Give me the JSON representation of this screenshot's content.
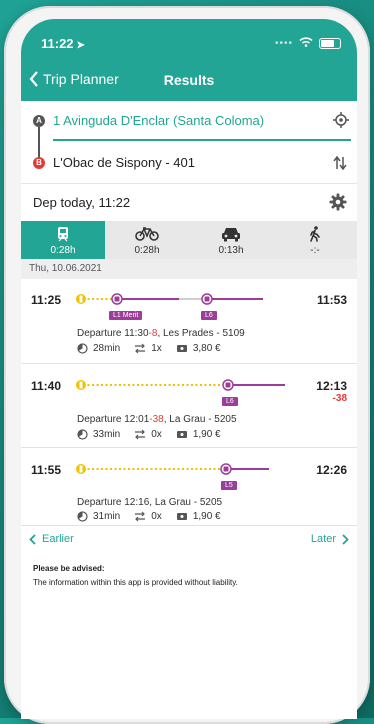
{
  "status": {
    "time": "11:22"
  },
  "nav": {
    "back_label": "Trip Planner",
    "title": "Results"
  },
  "trip": {
    "from": "1 Avinguda D'Enclar (Santa Coloma)",
    "to": "L'Obac de Sispony - 401",
    "from_marker": "A",
    "to_marker": "B",
    "departure": "Dep today, 11:22"
  },
  "modes": [
    {
      "name": "public-transport",
      "duration": "0:28h",
      "active": true
    },
    {
      "name": "bike",
      "duration": "0:28h",
      "active": false
    },
    {
      "name": "car",
      "duration": "0:13h",
      "active": false
    },
    {
      "name": "walk",
      "duration": "-:-",
      "active": false
    }
  ],
  "date": "Thu, 10.06.2021",
  "connections": [
    {
      "dep_time": "11:25",
      "arr_time": "11:53",
      "arr_delay": "",
      "labels": [
        "L1 Merit",
        "L6"
      ],
      "detail_prefix": "Departure 11:30",
      "detail_delay": "-8",
      "detail_suffix": ", Les Prades - 5109",
      "duration": "28min",
      "transfers": "1x",
      "price": "3,80 €"
    },
    {
      "dep_time": "11:40",
      "arr_time": "12:13",
      "arr_delay": "-38",
      "labels": [
        "L6"
      ],
      "detail_prefix": "Departure 12:01",
      "detail_delay": "-38",
      "detail_suffix": ", La Grau - 5205",
      "duration": "33min",
      "transfers": "0x",
      "price": "1,90 €"
    },
    {
      "dep_time": "11:55",
      "arr_time": "12:26",
      "arr_delay": "",
      "labels": [
        "L5"
      ],
      "detail_prefix": "Departure 12:16, La Grau - 5205",
      "detail_delay": "",
      "detail_suffix": "",
      "duration": "31min",
      "transfers": "0x",
      "price": "1,90 €"
    }
  ],
  "pager": {
    "earlier": "Earlier",
    "later": "Later"
  },
  "notice": {
    "title": "Please be advised:",
    "text": "The information within this app is provided without liability."
  },
  "colors": {
    "primary": "#23a595",
    "line": "#9c3d9a",
    "walk": "#f2c200",
    "delay": "#e53935"
  }
}
